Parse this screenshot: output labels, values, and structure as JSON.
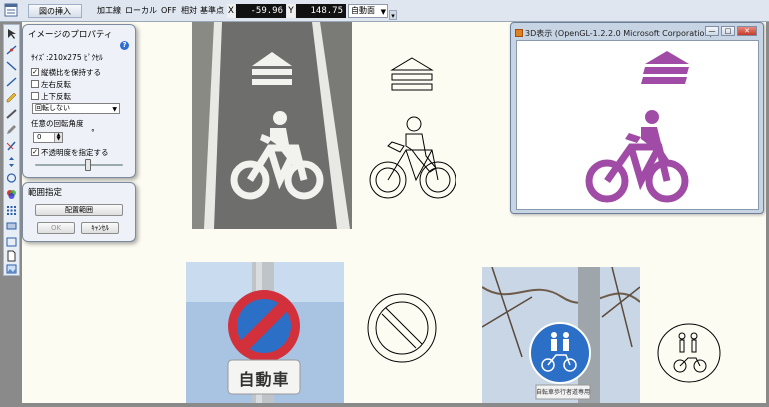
{
  "toolbar": {
    "insert_image_label": "図の挿入",
    "items": [
      "加工線",
      "ローカル",
      "OFF",
      "相対",
      "基準点"
    ],
    "x_label": "X",
    "x_value": "-59.96",
    "y_label": "Y",
    "y_value": "148.75",
    "mode_value": "自動面"
  },
  "image_props": {
    "title": "イメージのプロパティ",
    "size_text": "ｻｲｽﾞ:210x275 ﾋﾟｸｾﾙ",
    "keep_aspect": "縦横比を保持する",
    "flip_h": "左右反転",
    "flip_v": "上下反転",
    "rotate_value": "回転しない",
    "angle_label": "任意の回転角度",
    "angle_value": "0",
    "angle_unit": "°",
    "opacity_label": "不透明度を指定する",
    "keep_aspect_checked": true,
    "opacity_checked": true
  },
  "range_panel": {
    "title": "範囲指定",
    "placement_button": "配置範囲",
    "ok_button": "OK",
    "cancel_button": "ｷｬﾝｾﾙ"
  },
  "gl_window": {
    "title": "3D表示 (OpenGL-1.2.2.0 Microsoft Corporation)",
    "min_label": "—",
    "max_label": "□",
    "close_label": "✕"
  },
  "photos": {
    "car_sign_text": "自動車",
    "bike_sign_text": "自転車歩行者道専用"
  },
  "colors": {
    "accent_purple": "#a04ca6",
    "sign_red": "#d2313c",
    "sign_blue": "#2c6fc6"
  }
}
